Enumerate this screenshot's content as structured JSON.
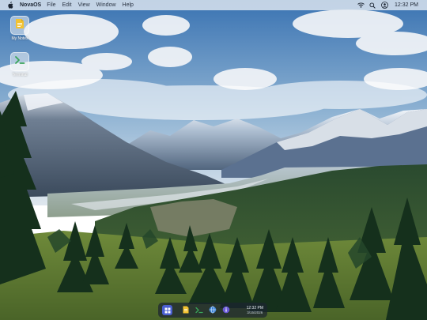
{
  "menubar": {
    "logo_icon": "apple-icon",
    "app_name": "NovaOS",
    "menus": [
      "File",
      "Edit",
      "View",
      "Window",
      "Help"
    ],
    "status_icons": [
      "wifi-icon",
      "search-icon",
      "user-icon"
    ],
    "clock": "12:32 PM"
  },
  "desktop": {
    "icons": [
      {
        "label": "My Notes",
        "icon": "notes-icon",
        "color": "#f2c230"
      },
      {
        "label": "Terminal",
        "icon": "terminal-icon",
        "color": "#3aa55a"
      }
    ]
  },
  "dock": {
    "items": [
      {
        "name": "launcher",
        "icon": "grid-icon",
        "color": "#4a5fd0"
      },
      {
        "name": "notes",
        "icon": "notes-icon",
        "color": "#f2c230"
      },
      {
        "name": "terminal",
        "icon": "terminal-icon",
        "color": "#3aa55a"
      },
      {
        "name": "browser",
        "icon": "globe-icon",
        "color": "#3b82d6"
      },
      {
        "name": "info",
        "icon": "info-icon",
        "color": "#6a5ad6"
      }
    ],
    "time": "12:32 PM",
    "date": "3/15/2026"
  },
  "wallpaper": {
    "sky_top": "#3f78b5",
    "sky_bottom": "#cfdde8",
    "forest": "#1e3a22",
    "meadow": "#6f8a3a"
  }
}
